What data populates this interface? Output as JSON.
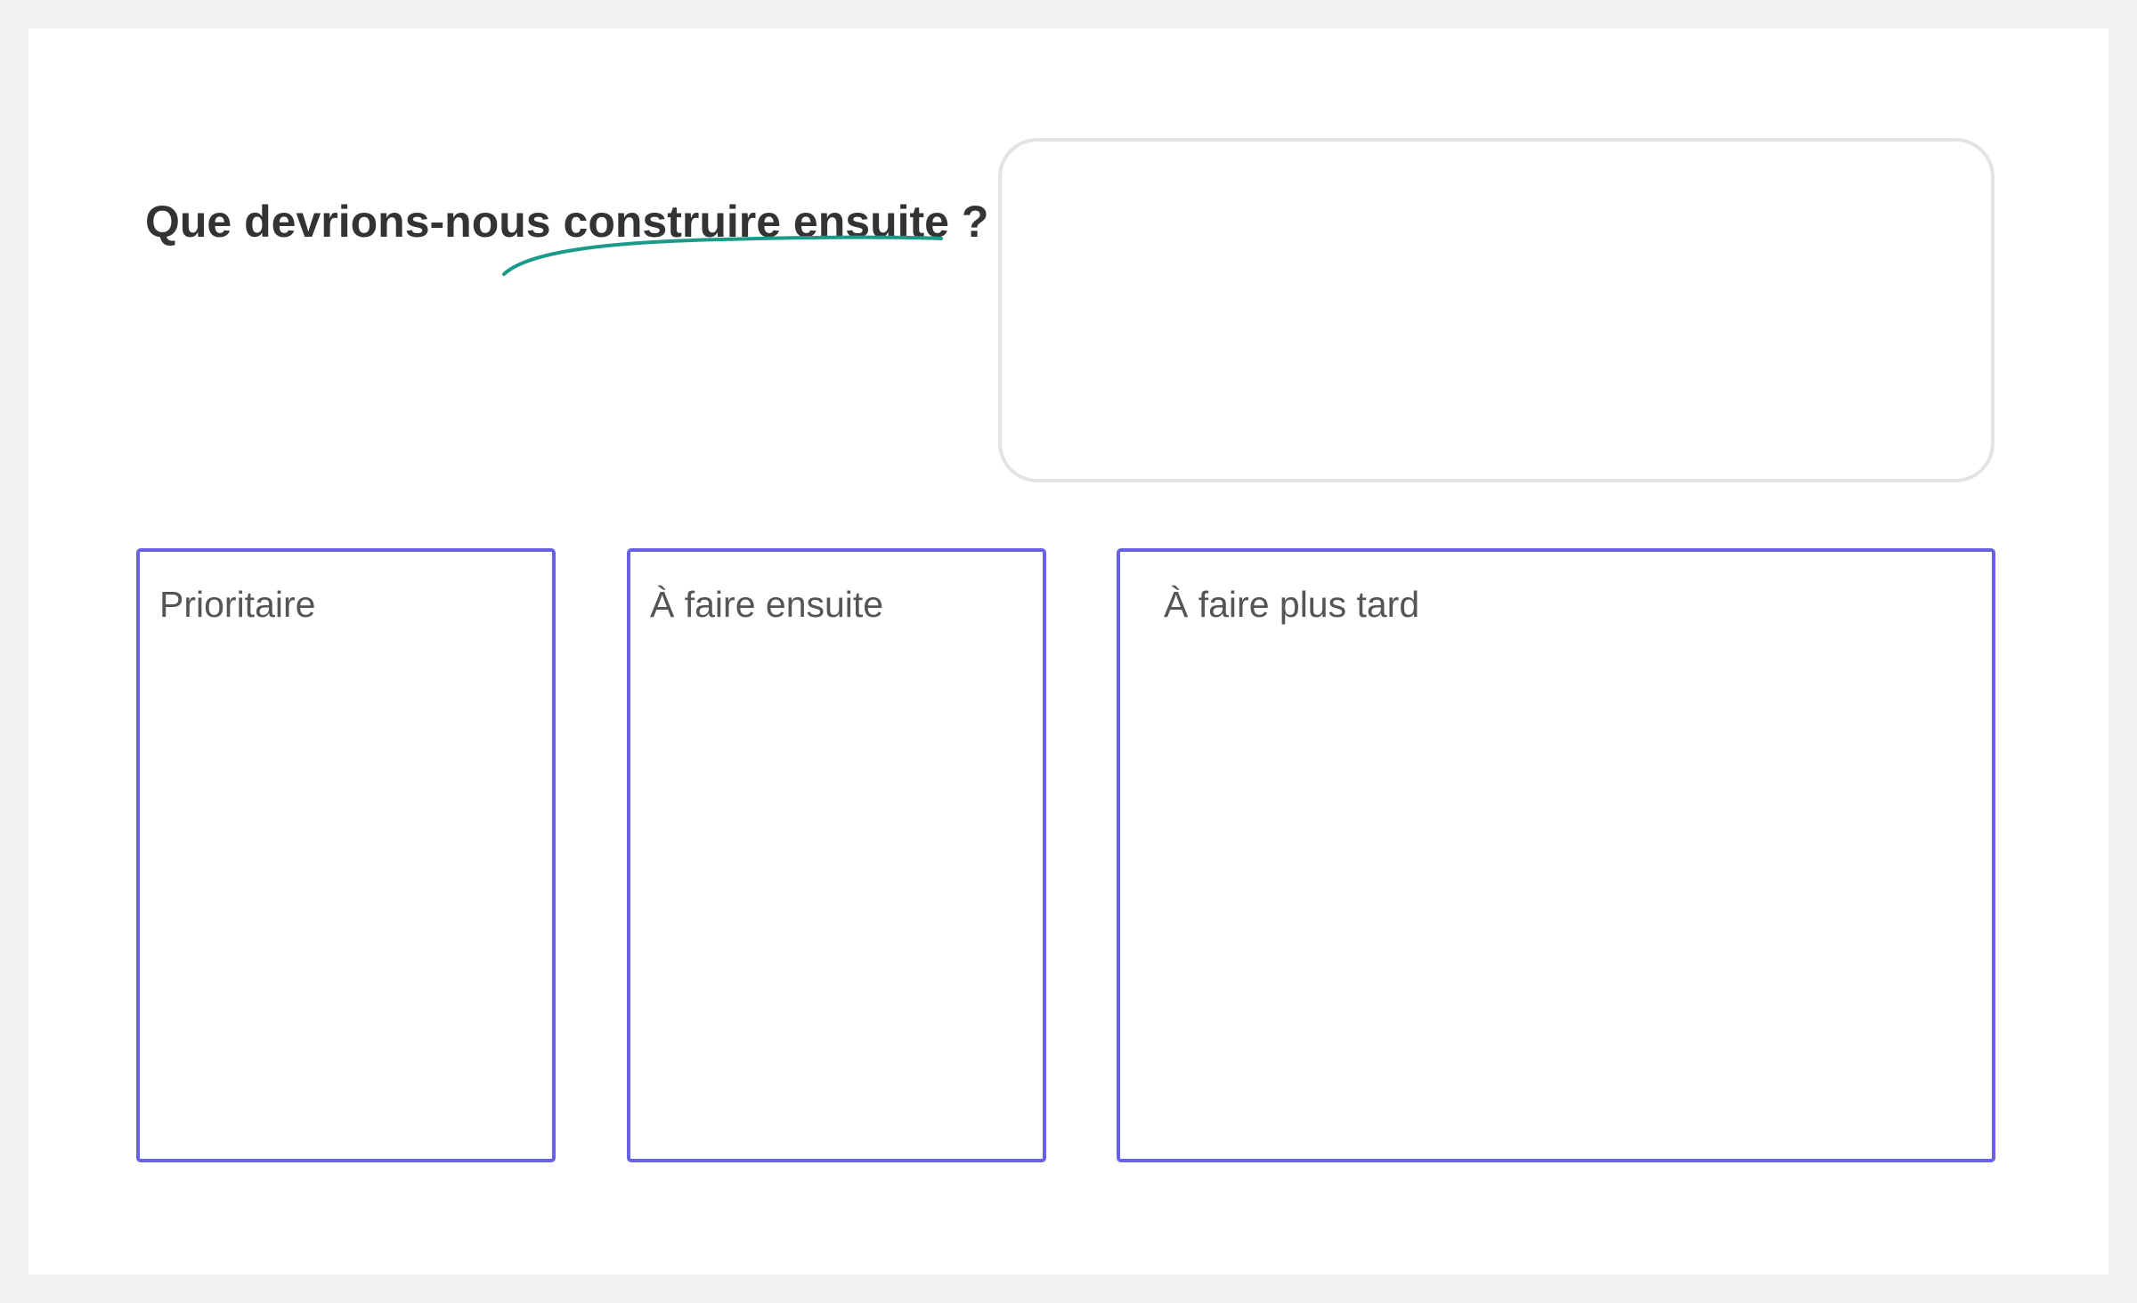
{
  "board": {
    "title": "Que devrions-nous construire ensuite ?",
    "accent_color": "#1a9b8a",
    "column_border_color": "#6961e3"
  },
  "columns": [
    {
      "label": "Prioritaire"
    },
    {
      "label": "À faire ensuite"
    },
    {
      "label": "À faire plus tard"
    }
  ]
}
